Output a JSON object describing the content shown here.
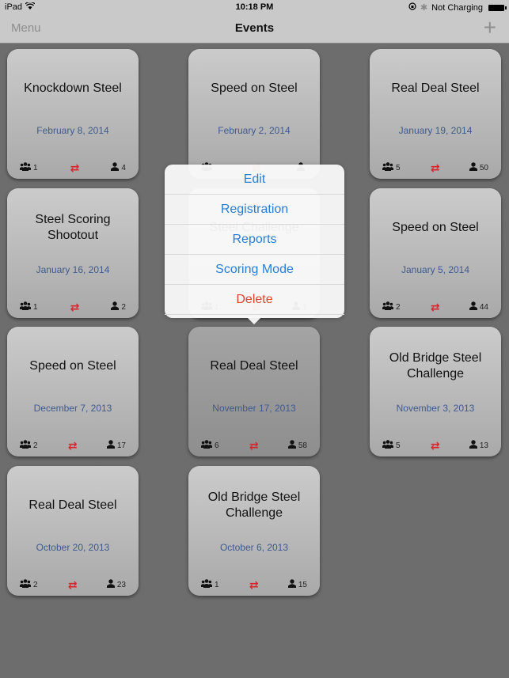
{
  "status_bar": {
    "device": "iPad",
    "time": "10:18 PM",
    "battery_status": "Not Charging"
  },
  "nav": {
    "left_label": "Menu",
    "title": "Events",
    "add_label": "+"
  },
  "icons": {
    "squads": "👥",
    "swap": "⇄",
    "shooters": "👤"
  },
  "colors": {
    "accent": "#2a7ed6",
    "destructive": "#e0442e",
    "date": "#3e5a8f",
    "swap": "#d9262e",
    "background": "#6d6d6d"
  },
  "events": [
    {
      "title": "Knockdown Steel",
      "date": "February 8, 2014",
      "squads": "1",
      "shooters": "4"
    },
    {
      "title": "Speed on Steel",
      "date": "February 2, 2014",
      "squads": "",
      "shooters": ""
    },
    {
      "title": "Real Deal Steel",
      "date": "January 19, 2014",
      "squads": "5",
      "shooters": "50"
    },
    {
      "title": "Steel Scoring Shootout",
      "date": "January 16, 2014",
      "squads": "1",
      "shooters": "2"
    },
    {
      "title": "Steel Challenge",
      "date": "",
      "squads": "1",
      "shooters": "1"
    },
    {
      "title": "Speed on Steel",
      "date": "January 5, 2014",
      "squads": "2",
      "shooters": "44"
    },
    {
      "title": "Speed on Steel",
      "date": "December 7, 2013",
      "squads": "2",
      "shooters": "17"
    },
    {
      "title": "Real Deal Steel",
      "date": "November 17, 2013",
      "squads": "6",
      "shooters": "58"
    },
    {
      "title": "Old Bridge Steel Challenge",
      "date": "November 3, 2013",
      "squads": "5",
      "shooters": "13"
    },
    {
      "title": "Real Deal Steel",
      "date": "October 20, 2013",
      "squads": "2",
      "shooters": "23"
    },
    {
      "title": "Old Bridge Steel Challenge",
      "date": "October 6, 2013",
      "squads": "1",
      "shooters": "15"
    }
  ],
  "popover": {
    "items": [
      {
        "label": "Edit"
      },
      {
        "label": "Registration"
      },
      {
        "label": "Reports"
      },
      {
        "label": "Scoring Mode"
      },
      {
        "label": "Delete"
      }
    ]
  }
}
